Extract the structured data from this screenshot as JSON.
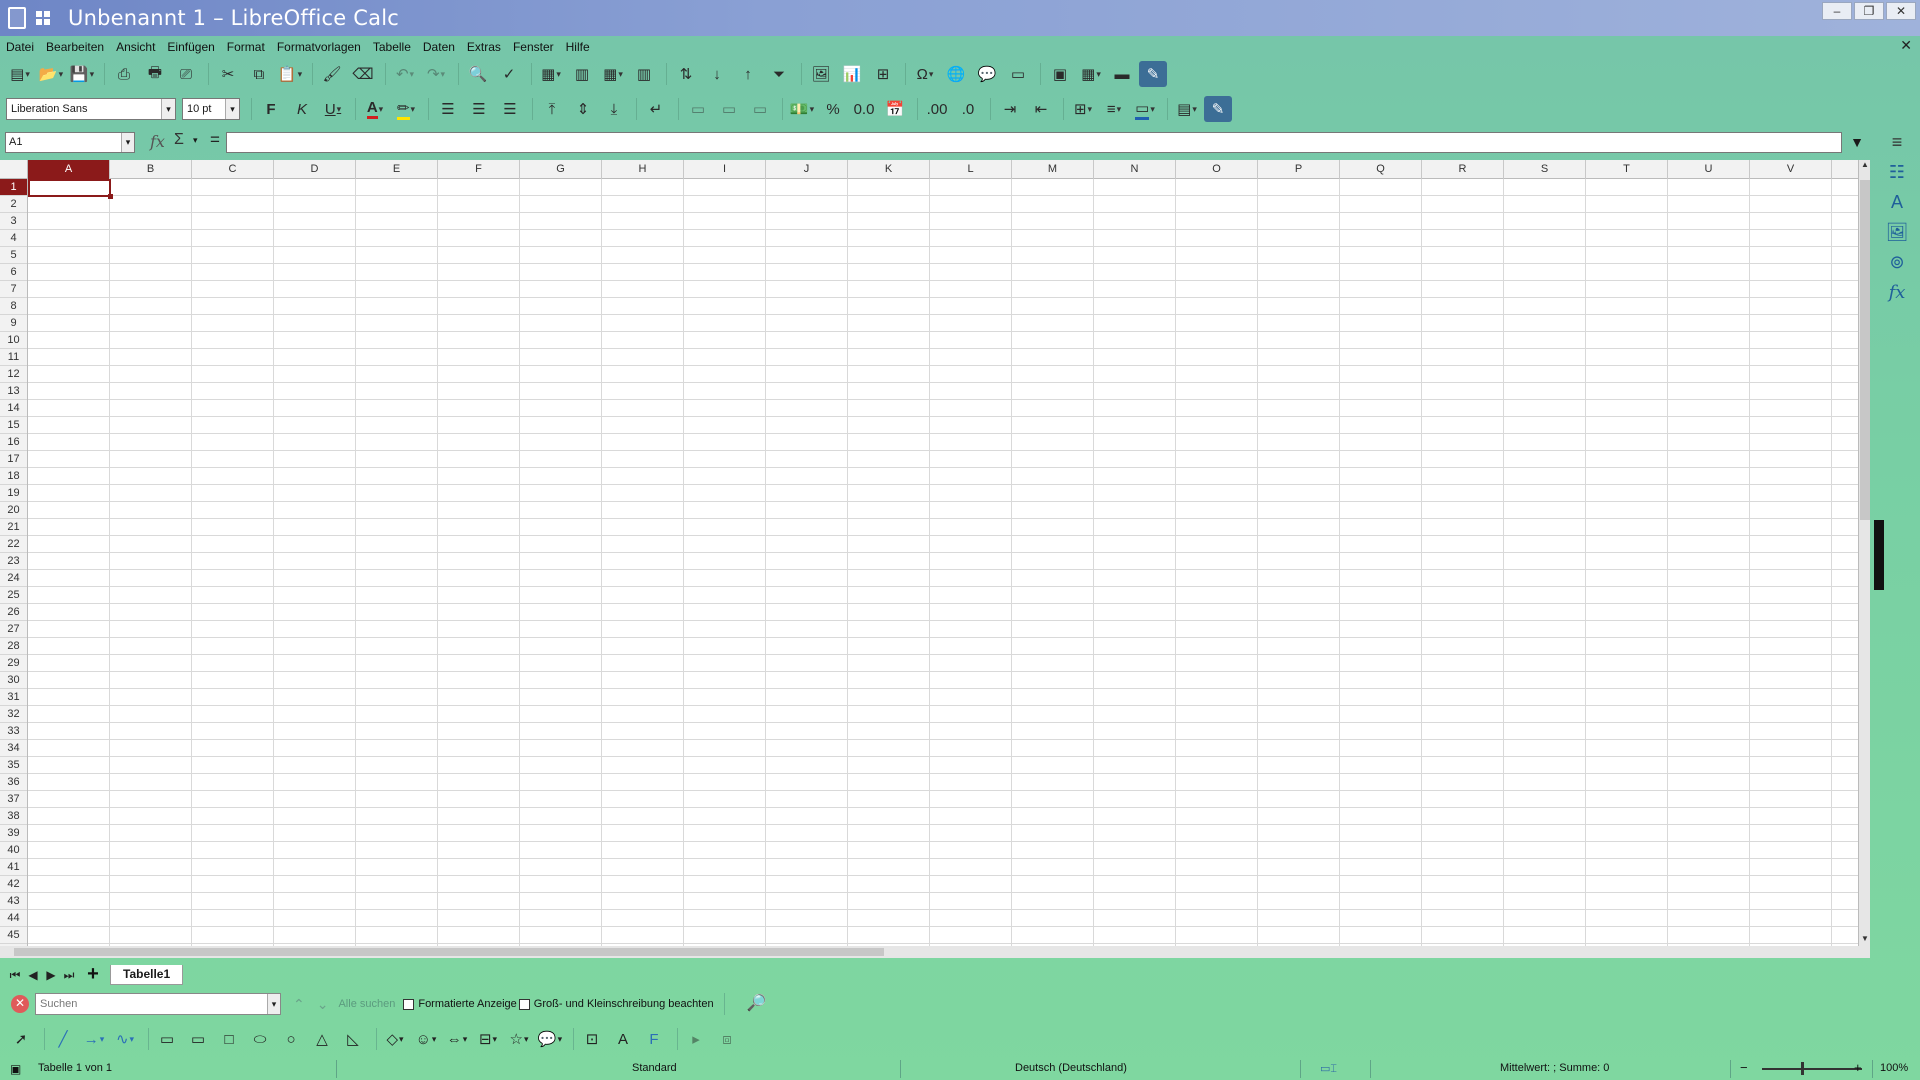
{
  "window": {
    "title": "Unbenannt 1 – LibreOffice Calc",
    "controls": [
      "–",
      "❐",
      "✕"
    ]
  },
  "menu": [
    "Datei",
    "Bearbeiten",
    "Ansicht",
    "Einfügen",
    "Format",
    "Formatvorlagen",
    "Tabelle",
    "Daten",
    "Extras",
    "Fenster",
    "Hilfe"
  ],
  "close_document": "✕",
  "formatting": {
    "font_name": "Liberation Sans",
    "font_size": "10 pt",
    "bold": "F",
    "italic": "K",
    "underline": "U"
  },
  "formula_bar": {
    "cell_reference": "A1",
    "fx": "fx",
    "sigma": "Σ",
    "equals": "=",
    "value": ""
  },
  "columns": [
    "A",
    "B",
    "C",
    "D",
    "E",
    "F",
    "G",
    "H",
    "I",
    "J",
    "K",
    "L",
    "M",
    "N",
    "O",
    "P",
    "Q",
    "R",
    "S",
    "T",
    "U",
    "V"
  ],
  "rows": [
    "1",
    "2",
    "3",
    "4",
    "5",
    "6",
    "7",
    "8",
    "9",
    "10",
    "11",
    "12",
    "13",
    "14",
    "15",
    "16",
    "17",
    "18",
    "19",
    "20",
    "21",
    "22",
    "23",
    "24",
    "25",
    "26",
    "27",
    "28",
    "29",
    "30",
    "31",
    "32",
    "33",
    "34",
    "35",
    "36",
    "37",
    "38",
    "39",
    "40",
    "41",
    "42",
    "43",
    "44",
    "45"
  ],
  "selected_column": "A",
  "selected_row": "1",
  "sheet_tabs": {
    "active": "Tabelle1"
  },
  "findbar": {
    "placeholder": "Suchen",
    "find_all": "Alle suchen",
    "formatted_display": "Formatierte Anzeige",
    "match_case": "Groß- und Kleinschreibung beachten"
  },
  "statusbar": {
    "sheet_position": "Tabelle 1 von 1",
    "page_style": "Standard",
    "language": "Deutsch (Deutschland)",
    "selection_summary": "Mittelwert: ; Summe: 0",
    "zoom_minus": "−",
    "zoom_plus": "+",
    "zoom": "100%"
  },
  "colors": {
    "accent_selection": "#8b1a1a",
    "titlebar": "#6e86c6",
    "chrome": "#7fd0a8"
  }
}
